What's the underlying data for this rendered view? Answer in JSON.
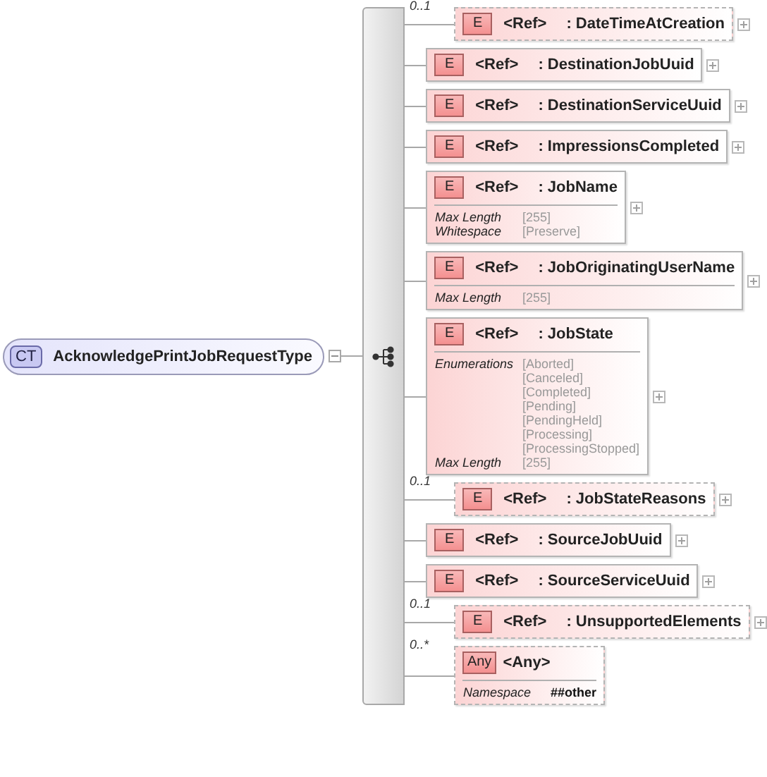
{
  "type_box": {
    "badge": "CT",
    "name": "AcknowledgePrintJobRequestType",
    "expanded": true
  },
  "elements": [
    {
      "kind": "element",
      "badge": "E",
      "ref": "<Ref>",
      "name": ": DateTimeAtCreation",
      "occurrence": "0..1",
      "optional": true,
      "expanded": false
    },
    {
      "kind": "element",
      "badge": "E",
      "ref": "<Ref>",
      "name": ": DestinationJobUuid",
      "optional": false,
      "expanded": false
    },
    {
      "kind": "element",
      "badge": "E",
      "ref": "<Ref>",
      "name": ": DestinationServiceUuid",
      "optional": false,
      "expanded": false
    },
    {
      "kind": "element",
      "badge": "E",
      "ref": "<Ref>",
      "name": ": ImpressionsCompleted",
      "optional": false,
      "expanded": false
    },
    {
      "kind": "element",
      "badge": "E",
      "ref": "<Ref>",
      "name": ": JobName",
      "optional": false,
      "expanded": false,
      "facets": [
        {
          "label": "Max Length",
          "values": [
            "[255]"
          ]
        },
        {
          "label": "Whitespace",
          "values": [
            "[Preserve]"
          ]
        }
      ]
    },
    {
      "kind": "element",
      "badge": "E",
      "ref": "<Ref>",
      "name": ": JobOriginatingUserName",
      "optional": false,
      "expanded": false,
      "facets": [
        {
          "label": "Max Length",
          "values": [
            "[255]"
          ]
        }
      ]
    },
    {
      "kind": "element",
      "badge": "E",
      "ref": "<Ref>",
      "name": ": JobState",
      "optional": false,
      "expanded": false,
      "facets": [
        {
          "label": "Enumerations",
          "values": [
            "[Aborted]",
            "[Canceled]",
            "[Completed]",
            "[Pending]",
            "[PendingHeld]",
            "[Processing]",
            "[ProcessingStopped]"
          ]
        },
        {
          "label": "Max Length",
          "values": [
            "[255]"
          ]
        }
      ]
    },
    {
      "kind": "element",
      "badge": "E",
      "ref": "<Ref>",
      "name": ": JobStateReasons",
      "occurrence": "0..1",
      "optional": true,
      "expanded": false
    },
    {
      "kind": "element",
      "badge": "E",
      "ref": "<Ref>",
      "name": ": SourceJobUuid",
      "optional": false,
      "expanded": false
    },
    {
      "kind": "element",
      "badge": "E",
      "ref": "<Ref>",
      "name": ": SourceServiceUuid",
      "optional": false,
      "expanded": false
    },
    {
      "kind": "element",
      "badge": "E",
      "ref": "<Ref>",
      "name": ": UnsupportedElements",
      "occurrence": "0..1",
      "optional": true,
      "expanded": false
    },
    {
      "kind": "any",
      "badge": "Any",
      "ref": "<Any>",
      "occurrence": "0..*",
      "optional": true,
      "facets": [
        {
          "label": "Namespace",
          "values": [
            "##other"
          ]
        }
      ]
    }
  ]
}
